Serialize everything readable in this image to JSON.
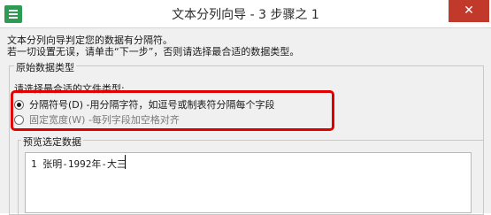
{
  "titlebar": {
    "title": "文本分列向导 - 3 步骤之 1",
    "close_glyph": "✕"
  },
  "description": {
    "line1": "文本分列向导判定您的数据有分隔符。",
    "line2": "若一切设置无误，请单击“下一步”，否则请选择最合适的数据类型。"
  },
  "original_data_group": {
    "caption": "原始数据类型"
  },
  "file_type_prompt": "请选择最合适的文件类型:",
  "options": [
    {
      "label": "分隔符号(D)  -用分隔字符，如逗号或制表符分隔每个字段",
      "checked": true
    },
    {
      "label": "固定宽度(W)  -每列字段加空格对齐",
      "checked": false
    }
  ],
  "preview_group": {
    "caption": "预览选定数据"
  },
  "preview": {
    "row_number": "1",
    "row_text": "张明-1992年-大三"
  },
  "colors": {
    "accent_green": "#2e9b52",
    "close_red": "#c0392b",
    "highlight_red": "#e00000"
  }
}
